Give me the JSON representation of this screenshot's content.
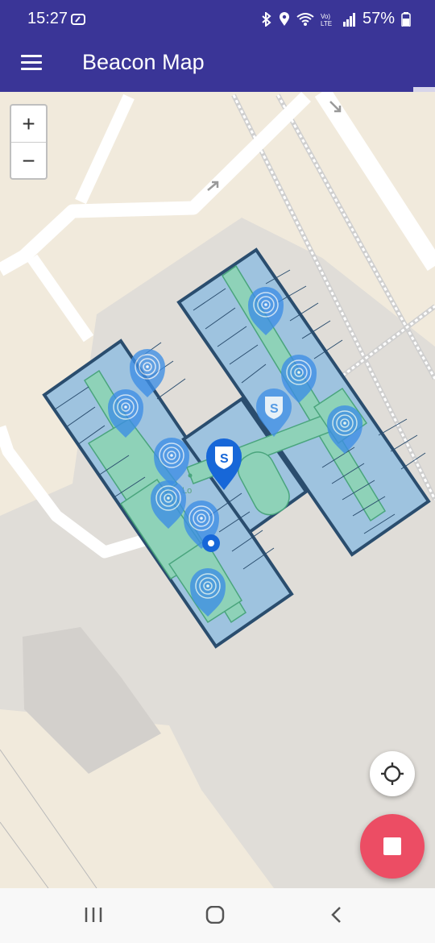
{
  "status_bar": {
    "time": "15:27",
    "battery": "57%",
    "icons": [
      "edge-icon",
      "bluetooth-icon",
      "location-icon",
      "wifi-icon",
      "volte-icon",
      "signal-icon",
      "battery-icon"
    ]
  },
  "app_bar": {
    "title": "Beacon Map",
    "menu_icon": "hamburger-menu-icon"
  },
  "progress": {
    "value": 0.95
  },
  "map": {
    "zoom_in_label": "+",
    "zoom_out_label": "−",
    "building_label": "Lo",
    "colors": {
      "background": "#f1eadc",
      "area": "#dedbd6",
      "roads": "#ffffff",
      "rooms": "#9ec3df",
      "corridors": "#8ed2b8",
      "walls": "#2a4d6e",
      "beacon": "#3d8ee6",
      "brand_marker": "#1767d8"
    },
    "beacon_count": 9,
    "markers": [
      "beacon-marker",
      "brand-s-marker",
      "user-location-dot"
    ]
  },
  "fab": {
    "locate_icon": "crosshair-icon",
    "stop_icon": "stop-icon",
    "stop_color": "#ec4d64"
  },
  "nav_bar": {
    "buttons": [
      "recent-apps-icon",
      "home-icon",
      "back-icon"
    ]
  }
}
